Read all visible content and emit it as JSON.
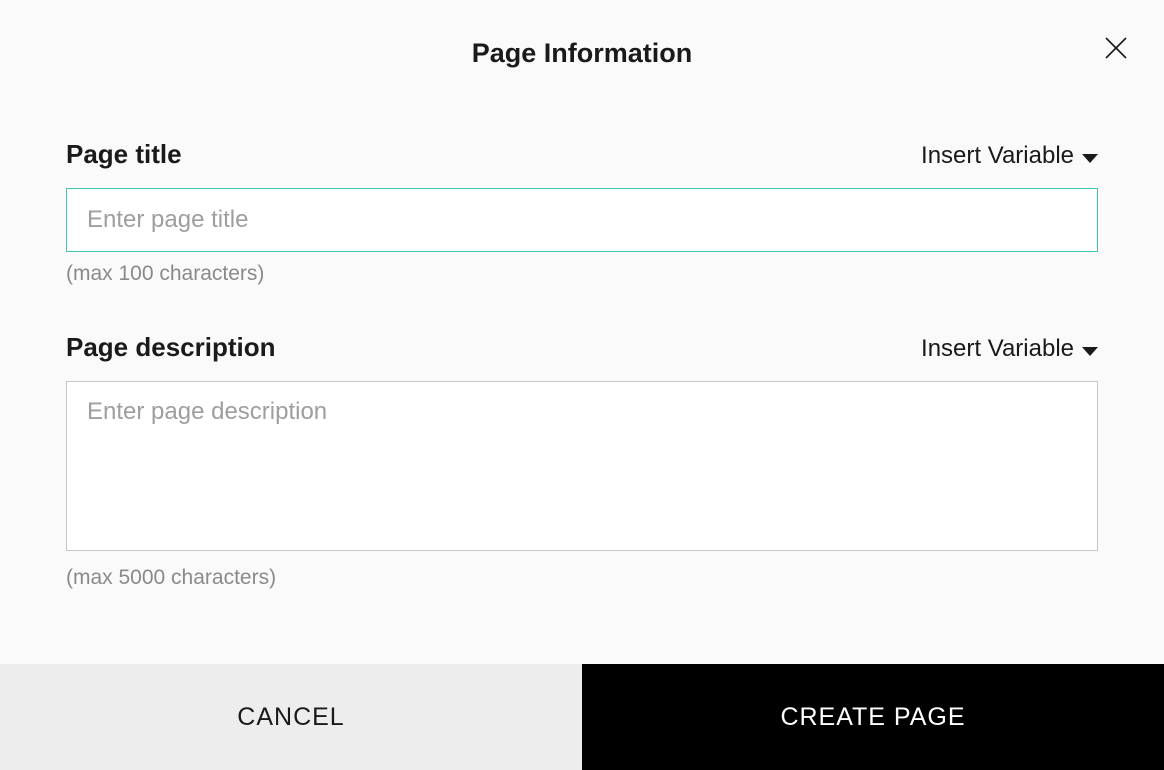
{
  "dialog": {
    "title": "Page Information"
  },
  "fields": {
    "title": {
      "label": "Page title",
      "placeholder": "Enter page title",
      "value": "",
      "hint": "(max 100 characters)",
      "insert_variable_label": "Insert Variable"
    },
    "description": {
      "label": "Page description",
      "placeholder": "Enter page description",
      "value": "",
      "hint": "(max 5000 characters)",
      "insert_variable_label": "Insert Variable"
    }
  },
  "actions": {
    "cancel": "CANCEL",
    "create": "CREATE PAGE"
  }
}
